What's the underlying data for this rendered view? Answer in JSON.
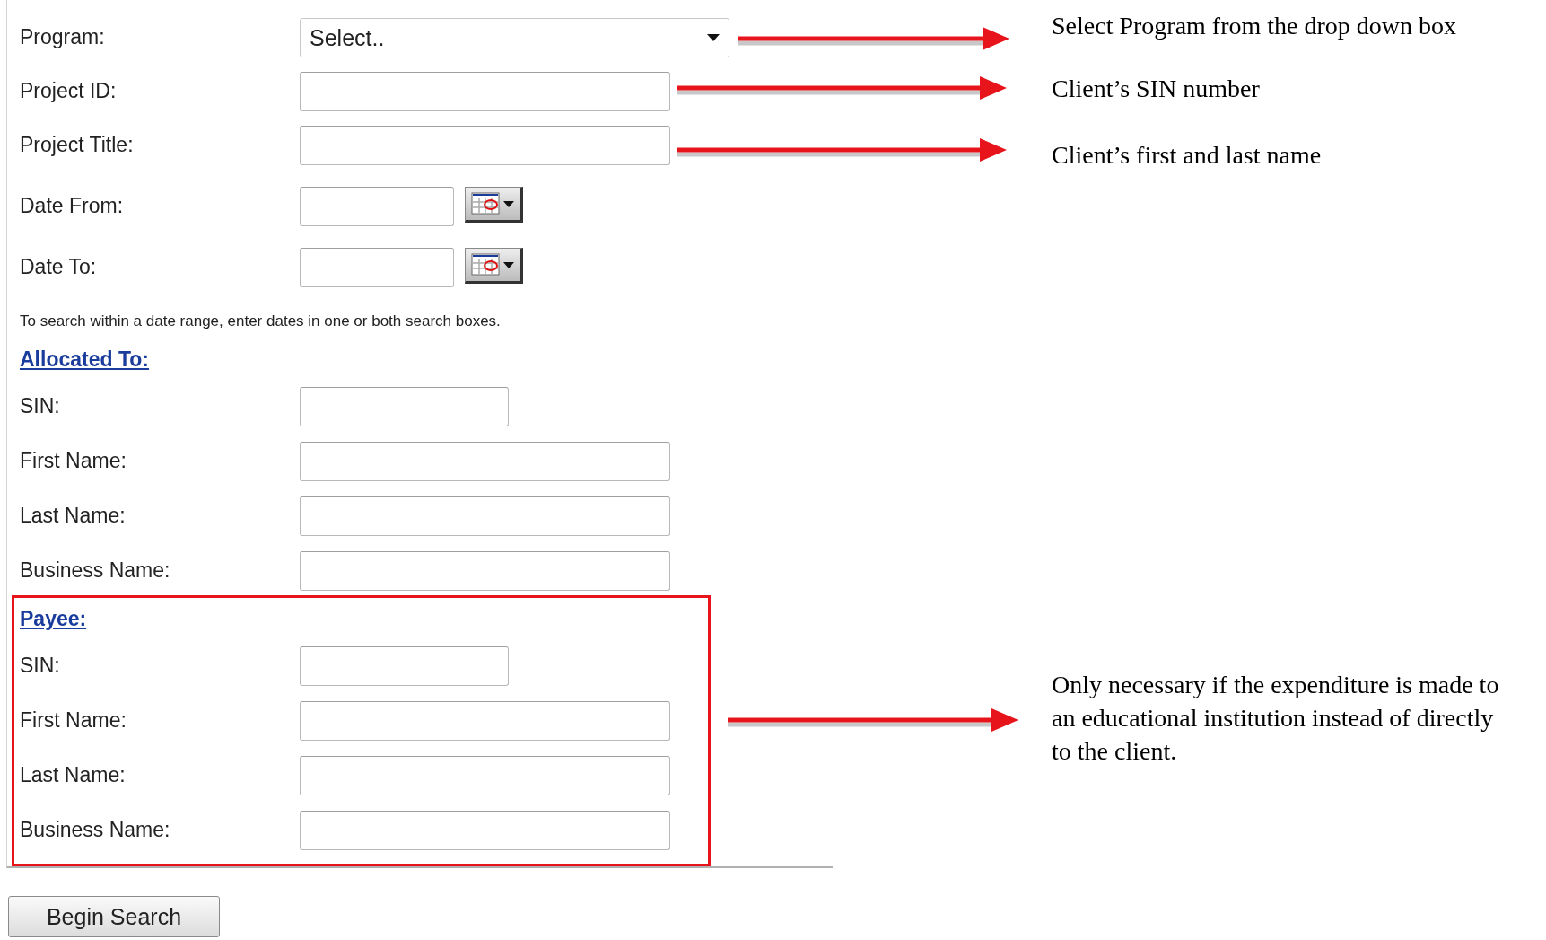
{
  "search_form": {
    "fields": [
      {
        "kind": "select",
        "label": "Program:",
        "value": "Select.."
      },
      {
        "kind": "text",
        "label": "Project ID:"
      },
      {
        "kind": "text",
        "label": "Project Title:"
      },
      {
        "kind": "date",
        "label": "Date From:"
      },
      {
        "kind": "date",
        "label": "Date To:"
      }
    ],
    "hint": "To search within a date range, enter dates in one or both search boxes.",
    "sections": [
      {
        "title": "Allocated To:",
        "highlighted": false,
        "fields": [
          {
            "kind": "short",
            "label": "SIN:"
          },
          {
            "kind": "text",
            "label": "First Name:"
          },
          {
            "kind": "text",
            "label": "Last Name:"
          },
          {
            "kind": "text",
            "label": "Business Name:"
          }
        ]
      },
      {
        "title": "Payee:",
        "highlighted": true,
        "fields": [
          {
            "kind": "short",
            "label": "SIN:"
          },
          {
            "kind": "text",
            "label": "First Name:"
          },
          {
            "kind": "text",
            "label": "Last Name:"
          },
          {
            "kind": "text",
            "label": "Business Name:"
          }
        ]
      }
    ],
    "button": "Begin Search"
  },
  "annotations": [
    {
      "text": "Select Program from the drop down box"
    },
    {
      "text": "Client’s SIN number"
    },
    {
      "text": "Client’s first and last name"
    },
    {
      "text": "Only necessary if the expenditure is made to an educational institution instead of directly to the client."
    }
  ]
}
